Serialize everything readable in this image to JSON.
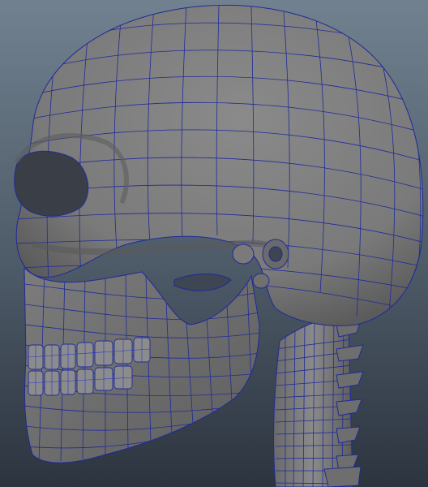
{
  "viewport": {
    "background_top": "#6f7f8e",
    "background_bottom": "#2d3540",
    "mesh_fill": "#7e7e7e",
    "mesh_shadow": "#5a5a5a",
    "wire_color": "#1f2a9a",
    "selected_wire_color": "#2a35c8"
  },
  "scene": {
    "object": "skull-wireframe-model",
    "shading": "wireframe-on-shaded"
  }
}
